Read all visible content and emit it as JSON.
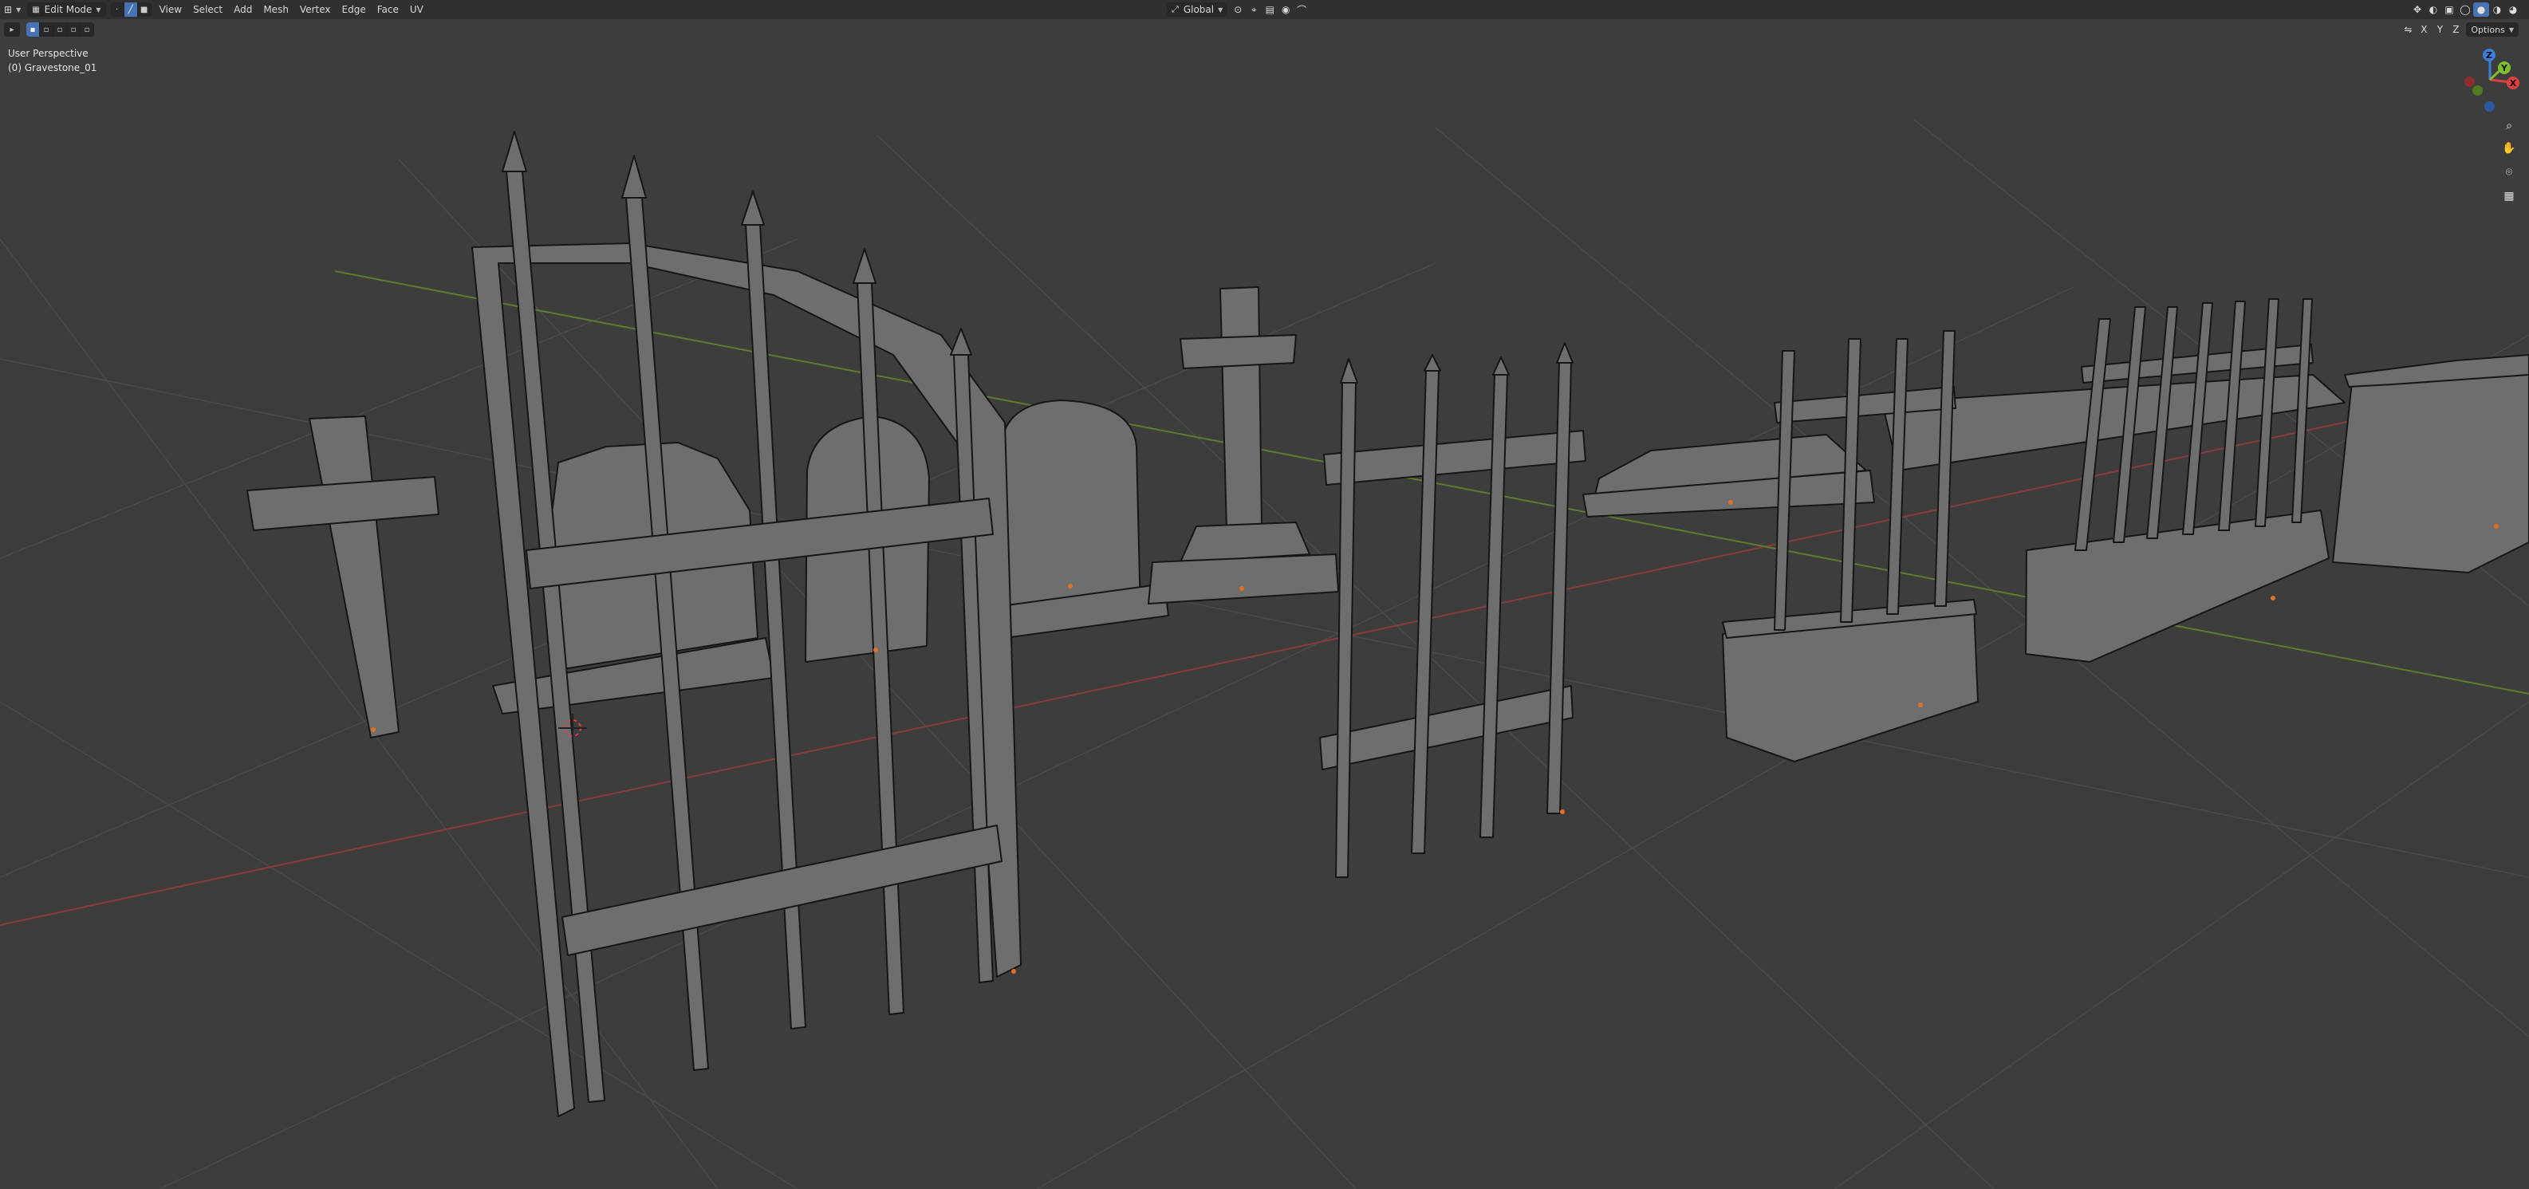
{
  "header": {
    "mode_label": "Edit Mode",
    "menus": [
      "View",
      "Select",
      "Add",
      "Mesh",
      "Vertex",
      "Edge",
      "Face",
      "UV"
    ],
    "transform_orientation": "Global",
    "options_label": "Options",
    "axis_toggles": [
      "X",
      "Y",
      "Z"
    ]
  },
  "overlay": {
    "view_name": "User Perspective",
    "object_name": "(0) Gravestone_01"
  },
  "gizmo": {
    "axes": [
      "X",
      "Y",
      "Z"
    ],
    "colors": {
      "x": "#e0413f",
      "y": "#7fbf2a",
      "z": "#3b7fd6"
    }
  },
  "icons": {
    "zoom": "zoom-icon",
    "pan": "hand-icon",
    "camera": "camera-icon",
    "grid": "grid-icon"
  }
}
